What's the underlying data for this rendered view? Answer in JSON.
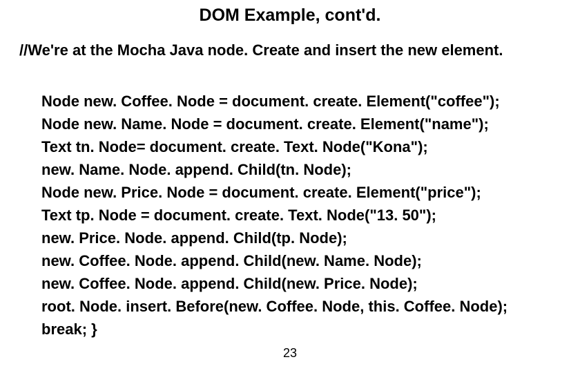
{
  "title": "DOM Example, cont'd.",
  "comment": "//We're at the Mocha Java node. Create and insert the new element.",
  "code": {
    "l0": "Node new. Coffee. Node = document. create. Element(\"coffee\");",
    "l1": "Node new. Name. Node = document. create. Element(\"name\");",
    "l2": "Text tn. Node= document. create. Text. Node(\"Kona\");",
    "l3": "new. Name. Node. append. Child(tn. Node);",
    "l4": "Node new. Price. Node = document. create. Element(\"price\");",
    "l5": "Text tp. Node = document. create. Text. Node(\"13. 50\");",
    "l6": "new. Price. Node. append. Child(tp. Node);",
    "l7": "new. Coffee. Node. append. Child(new. Name. Node);",
    "l8": "new. Coffee. Node. append. Child(new. Price. Node);",
    "l9": "root. Node. insert. Before(new. Coffee. Node, this. Coffee. Node);",
    "l10": "break; }"
  },
  "page_number": "23"
}
